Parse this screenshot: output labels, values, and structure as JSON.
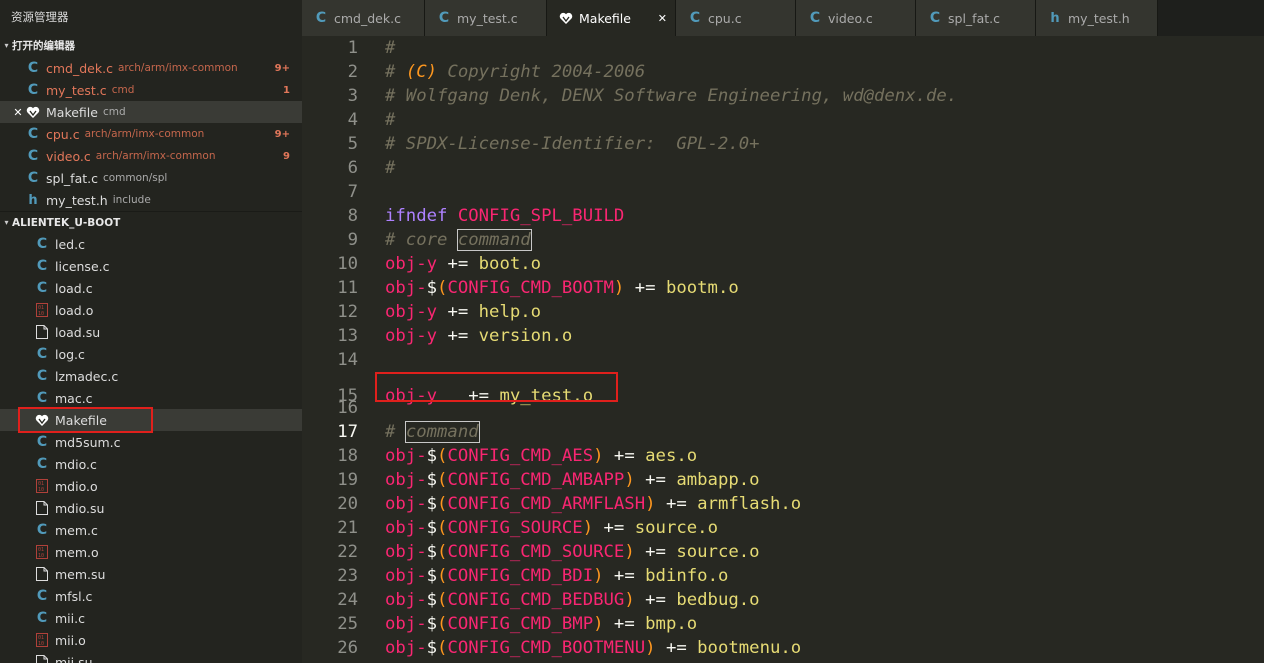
{
  "sidebar": {
    "title": "资源管理器",
    "open_editors_header": "打开的编辑器",
    "open_editors": [
      {
        "name": "cmd_dek.c",
        "dir": "arch/arm/imx-common",
        "badge": "9+",
        "icon": "c-icon",
        "modified": true
      },
      {
        "name": "my_test.c",
        "dir": "cmd",
        "badge": "1",
        "icon": "c-icon",
        "modified": true
      },
      {
        "name": "Makefile",
        "dir": "cmd",
        "badge": "",
        "icon": "makefile-icon",
        "modified": false,
        "active": true
      },
      {
        "name": "cpu.c",
        "dir": "arch/arm/imx-common",
        "badge": "9+",
        "icon": "c-icon",
        "modified": true
      },
      {
        "name": "video.c",
        "dir": "arch/arm/imx-common",
        "badge": "9",
        "icon": "c-icon",
        "modified": true
      },
      {
        "name": "spl_fat.c",
        "dir": "common/spl",
        "badge": "",
        "icon": "c-icon",
        "modified": false
      },
      {
        "name": "my_test.h",
        "dir": "include",
        "badge": "",
        "icon": "h-icon",
        "modified": false
      }
    ],
    "project_header": "ALIENTEK_U-BOOT",
    "tree": [
      {
        "name": "led.c",
        "icon": "c-icon"
      },
      {
        "name": "license.c",
        "icon": "c-icon"
      },
      {
        "name": "load.c",
        "icon": "c-icon"
      },
      {
        "name": "load.o",
        "icon": "binary-icon"
      },
      {
        "name": "load.su",
        "icon": "file-icon"
      },
      {
        "name": "log.c",
        "icon": "c-icon"
      },
      {
        "name": "lzmadec.c",
        "icon": "c-icon"
      },
      {
        "name": "mac.c",
        "icon": "c-icon"
      },
      {
        "name": "Makefile",
        "icon": "makefile-icon",
        "selected": true
      },
      {
        "name": "md5sum.c",
        "icon": "c-icon"
      },
      {
        "name": "mdio.c",
        "icon": "c-icon"
      },
      {
        "name": "mdio.o",
        "icon": "binary-icon"
      },
      {
        "name": "mdio.su",
        "icon": "file-icon"
      },
      {
        "name": "mem.c",
        "icon": "c-icon"
      },
      {
        "name": "mem.o",
        "icon": "binary-icon"
      },
      {
        "name": "mem.su",
        "icon": "file-icon"
      },
      {
        "name": "mfsl.c",
        "icon": "c-icon"
      },
      {
        "name": "mii.c",
        "icon": "c-icon"
      },
      {
        "name": "mii.o",
        "icon": "binary-icon"
      },
      {
        "name": "mii.su",
        "icon": "file-icon"
      }
    ]
  },
  "tabs": [
    {
      "label": "cmd_dek.c",
      "icon": "c-icon"
    },
    {
      "label": "my_test.c",
      "icon": "c-icon"
    },
    {
      "label": "Makefile",
      "icon": "makefile-icon",
      "active": true,
      "close": "✕"
    },
    {
      "label": "cpu.c",
      "icon": "c-icon"
    },
    {
      "label": "video.c",
      "icon": "c-icon"
    },
    {
      "label": "spl_fat.c",
      "icon": "c-icon"
    },
    {
      "label": "my_test.h",
      "icon": "h-icon"
    }
  ],
  "editor": {
    "current_line": 17,
    "lines": [
      {
        "n": "1",
        "t": "#"
      },
      {
        "n": "2",
        "t": "# (C) Copyright 2004-2006"
      },
      {
        "n": "3",
        "t": "# Wolfgang Denk, DENX Software Engineering, wd@denx.de."
      },
      {
        "n": "4",
        "t": "#"
      },
      {
        "n": "5",
        "t": "# SPDX-License-Identifier:  GPL-2.0+"
      },
      {
        "n": "6",
        "t": "#"
      },
      {
        "n": "7",
        "t": ""
      },
      {
        "n": "8",
        "t": "ifndef CONFIG_SPL_BUILD"
      },
      {
        "n": "9",
        "t": "# core command"
      },
      {
        "n": "10",
        "t": "obj-y += boot.o"
      },
      {
        "n": "11",
        "t": "obj-$(CONFIG_CMD_BOOTM) += bootm.o"
      },
      {
        "n": "12",
        "t": "obj-y += help.o"
      },
      {
        "n": "13",
        "t": "obj-y += version.o"
      },
      {
        "n": "14",
        "t": ""
      },
      {
        "n": "15",
        "t": "obj-y   += my_test.o"
      },
      {
        "n": "16",
        "t": ""
      },
      {
        "n": "17",
        "t": "# command"
      },
      {
        "n": "18",
        "t": "obj-$(CONFIG_CMD_AES) += aes.o"
      },
      {
        "n": "19",
        "t": "obj-$(CONFIG_CMD_AMBAPP) += ambapp.o"
      },
      {
        "n": "20",
        "t": "obj-$(CONFIG_CMD_ARMFLASH) += armflash.o"
      },
      {
        "n": "21",
        "t": "obj-$(CONFIG_SOURCE) += source.o"
      },
      {
        "n": "22",
        "t": "obj-$(CONFIG_CMD_SOURCE) += source.o"
      },
      {
        "n": "23",
        "t": "obj-$(CONFIG_CMD_BDI) += bdinfo.o"
      },
      {
        "n": "24",
        "t": "obj-$(CONFIG_CMD_BEDBUG) += bedbug.o"
      },
      {
        "n": "25",
        "t": "obj-$(CONFIG_CMD_BMP) += bmp.o"
      },
      {
        "n": "26",
        "t": "obj-$(CONFIG_CMD_BOOTMENU) += bootmenu.o"
      }
    ]
  },
  "colors": {
    "background": "#272822",
    "sidebar": "#23241f",
    "comment": "#75715e",
    "keyword": "#f92672",
    "string": "#e6db74",
    "config": "#fd971f",
    "c_icon": "#519aba",
    "highlight_box": "#e0201c"
  }
}
